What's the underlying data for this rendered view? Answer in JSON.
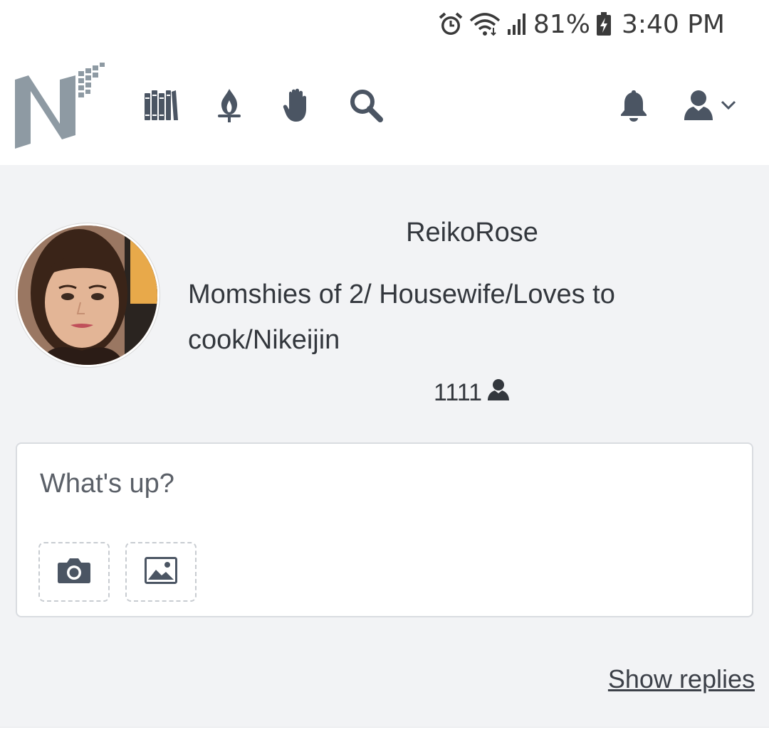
{
  "status_bar": {
    "battery": "81%",
    "time": "3:40 PM",
    "icons": [
      "alarm-icon",
      "wifi-icon",
      "signal-icon",
      "battery-charging-icon"
    ]
  },
  "header": {
    "nav": [
      {
        "name": "library-icon"
      },
      {
        "name": "torch-icon"
      },
      {
        "name": "raised-hand-icon"
      },
      {
        "name": "search-icon"
      }
    ],
    "right": [
      {
        "name": "bell-icon"
      },
      {
        "name": "user-icon"
      },
      {
        "name": "chevron-down-icon"
      }
    ]
  },
  "profile": {
    "username": "ReikoRose",
    "bio": "Momshies of 2/ Housewife/Loves to cook/Nikeijin",
    "followers": "1111"
  },
  "composer": {
    "placeholder": "What's up?",
    "buttons": [
      {
        "name": "camera-icon"
      },
      {
        "name": "image-icon"
      }
    ]
  },
  "footer": {
    "show_replies": "Show replies"
  },
  "colors": {
    "background": "#f2f3f5",
    "card": "#ffffff",
    "text": "#33373d",
    "icon": "#4b5563",
    "logo": "#8e9aa3"
  }
}
